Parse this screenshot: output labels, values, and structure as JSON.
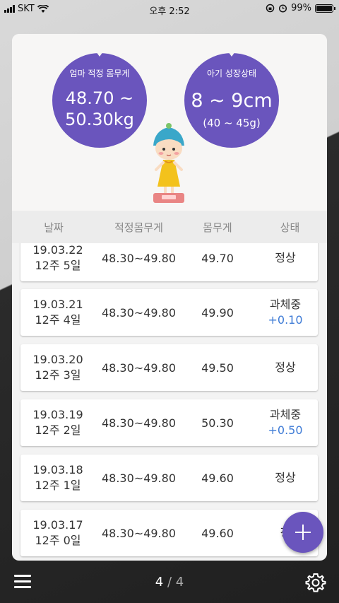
{
  "status_bar": {
    "carrier": "SKT",
    "time": "오후 2:52",
    "battery": "99%"
  },
  "mom_bubble": {
    "title": "엄마 적정 몸무게",
    "value_line1": "48.70 ~",
    "value_line2": "50.30kg"
  },
  "baby_bubble": {
    "title": "아기 성장상태",
    "value": "8 ~ 9cm",
    "sub": "(40 ~ 45g)"
  },
  "table": {
    "headers": [
      "날짜",
      "적정몸무게",
      "몸무게",
      "상태"
    ],
    "rows": [
      {
        "date": "19.03.22",
        "week": "12주 5일",
        "range": "48.30~49.80",
        "weight": "49.70",
        "status": "정상",
        "delta": ""
      },
      {
        "date": "19.03.21",
        "week": "12주 4일",
        "range": "48.30~49.80",
        "weight": "49.90",
        "status": "과체중",
        "delta": "+0.10"
      },
      {
        "date": "19.03.20",
        "week": "12주 3일",
        "range": "48.30~49.80",
        "weight": "49.50",
        "status": "정상",
        "delta": ""
      },
      {
        "date": "19.03.19",
        "week": "12주 2일",
        "range": "48.30~49.80",
        "weight": "50.30",
        "status": "과체중",
        "delta": "+0.50"
      },
      {
        "date": "19.03.18",
        "week": "12주 1일",
        "range": "48.30~49.80",
        "weight": "49.60",
        "status": "정상",
        "delta": ""
      },
      {
        "date": "19.03.17",
        "week": "12주 0일",
        "range": "48.30~49.80",
        "weight": "49.60",
        "status": "정",
        "delta": ""
      }
    ]
  },
  "pager": {
    "current": "4",
    "separator": "/",
    "total": "4"
  },
  "colors": {
    "accent": "#6a55bd",
    "delta": "#3e7bd6"
  },
  "icons": {
    "menu": "menu-icon",
    "settings": "gear-icon",
    "add": "plus-icon"
  }
}
